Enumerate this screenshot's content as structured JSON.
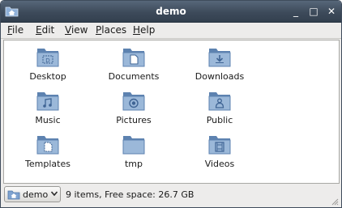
{
  "window": {
    "title": "demo",
    "controls": {
      "minimize": "_",
      "maximize": "□",
      "close": "✕"
    }
  },
  "menu": [
    "File",
    "Edit",
    "View",
    "Places",
    "Help"
  ],
  "items": [
    {
      "label": "Desktop",
      "emblem": "desktop-icon"
    },
    {
      "label": "Documents",
      "emblem": "documents-icon"
    },
    {
      "label": "Downloads",
      "emblem": "download-icon"
    },
    {
      "label": "Music",
      "emblem": "music-note-icon"
    },
    {
      "label": "Pictures",
      "emblem": "camera-icon"
    },
    {
      "label": "Public",
      "emblem": "person-icon"
    },
    {
      "label": "Templates",
      "emblem": "template-icon"
    },
    {
      "label": "tmp",
      "emblem": ""
    },
    {
      "label": "Videos",
      "emblem": "film-icon"
    }
  ],
  "statusbar": {
    "location": "demo",
    "status": "9 items, Free space: 26.7 GB"
  },
  "colors": {
    "folder_light": "#9bb8d9",
    "folder_dark": "#5d82b0",
    "titlebar": "#3d4a5a"
  }
}
